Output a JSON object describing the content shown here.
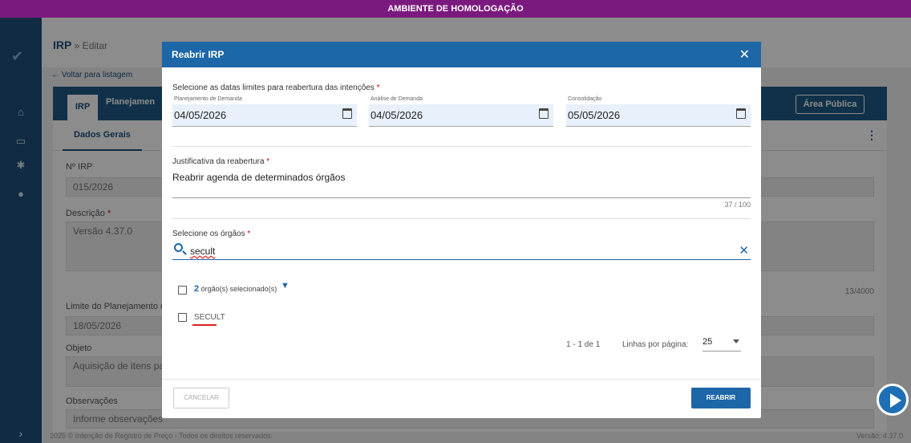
{
  "env_banner": "AMBIENTE DE HOMOLOGAÇÃO",
  "breadcrumb": {
    "title": "IRP",
    "sub": " » Editar"
  },
  "back_link": "← Voltar para listagem",
  "tabs": [
    "IRP",
    "Planejamen"
  ],
  "public_button": "Área Pública",
  "subtabs": {
    "active": "Dados Gerais",
    "more": "⋮"
  },
  "form": {
    "irp_label": "Nº IRP",
    "irp_value": "015/2026",
    "desc_label": "Descrição",
    "desc_value": "Versão 4.37.0",
    "desc_counter": "13/4000",
    "limit_label": "Limite do Planejamento de",
    "limit_value": "18/05/2026",
    "objeto_label": "Objeto",
    "objeto_value": "Aquisição de itens para",
    "obs_label": "Observações",
    "obs_placeholder": "Informe observações"
  },
  "footer": {
    "copyright": "2025 © Intenção de Registro de Preço - Todos os direitos reservados.",
    "version": "Versão: 4.37.0"
  },
  "modal": {
    "title": "Reabrir IRP",
    "dates_label": "Selecione as datas limites para reabertura das intenções",
    "dates": [
      {
        "label": "Planejamento de Demanda",
        "value": "04/05/2026"
      },
      {
        "label": "Análise de Demanda",
        "value": "04/05/2026"
      },
      {
        "label": "Consolidação",
        "value": "05/05/2026"
      }
    ],
    "justification_label": "Justificativa da reabertura",
    "justification_value": "Reabrir agenda de determinados órgãos",
    "justification_count": "37 / 100",
    "orgs_label": "Selecione os órgãos",
    "search_value": "secult",
    "selected_count": "2",
    "selected_text": "órgão(s) selecionado(s)",
    "org_items": [
      "SECULT"
    ],
    "pager": {
      "range": "1 - 1 de 1",
      "rows_label": "Linhas por página:",
      "rows_value": "25"
    },
    "cancel_label": "CANCELAR",
    "confirm_label": "REABRIR"
  }
}
